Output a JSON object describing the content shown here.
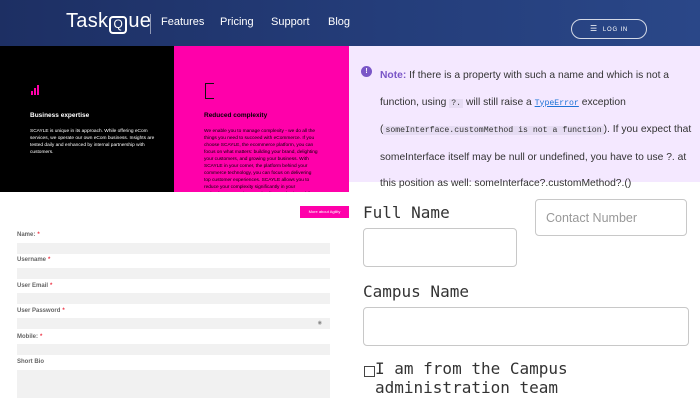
{
  "header": {
    "logo_before": "Task",
    "logo_q": "Q",
    "logo_after": "ue",
    "nav": [
      "Features",
      "Pricing",
      "Support",
      "Blog"
    ],
    "login_label": "LOG IN",
    "login_icon": "☰",
    "colors": {
      "bg": "#243d7a"
    }
  },
  "left_panels": {
    "black": {
      "title": "Business expertise",
      "body": "SCAYLE is unique in its approach. While offering eCom services, we operate our own eCom business. Insights are tested daily and enhanced by internal partnership with customers.",
      "icon": "bar-chart-icon"
    },
    "pink": {
      "title": "Reduced complexity",
      "body": "We enable you to manage complexity - we do all the things you need to succeed with eCommerce. If you choose SCAYLE, the ecommerce platform, you can focus on what matters: building your brand, delighting your customers, and growing your business. With SCAYLE in your corner, the platform behind your commerce technology, you can focus on delivering top customer experiences. SCAYLE allows you to reduce your complexity significantly in your technology, operations, and online marketing, while allowing you to focus on what really differentiates your business.",
      "cta": "More about Agility",
      "icon": "bracket-icon",
      "color": "#ff00aa"
    }
  },
  "left_form": {
    "fields": [
      {
        "label": "Name:",
        "required": true
      },
      {
        "label": "Username",
        "required": true
      },
      {
        "label": "User Email",
        "required": true
      },
      {
        "label": "User Password",
        "required": true,
        "icon": "eye-icon",
        "icon_glyph": "◉"
      },
      {
        "label": "Mobile:",
        "required": true
      },
      {
        "label": "Short Bio",
        "required": false
      }
    ],
    "required_marker": "*"
  },
  "note": {
    "icon_glyph": "!",
    "label": "Note:",
    "t1": " If there is a property with such a name and which is not a function, using ",
    "c1": "?.",
    "t2": " will still raise a ",
    "c2": "TypeError",
    "t3": " exception (",
    "c3": "someInterface.customMethod is not a function",
    "t4": "). If you expect that someInterface itself may be null or undefined, you have to use ?. at this position as well: someInterface?.customMethod?.()",
    "colors": {
      "bg": "#f4e8ff",
      "accent": "#7a56c7"
    }
  },
  "right_form": {
    "full_name_label": "Full Name",
    "contact_placeholder": "Contact Number",
    "campus_name_label": "Campus Name",
    "admin_checkbox_label": "I am from the Campus administration team"
  }
}
